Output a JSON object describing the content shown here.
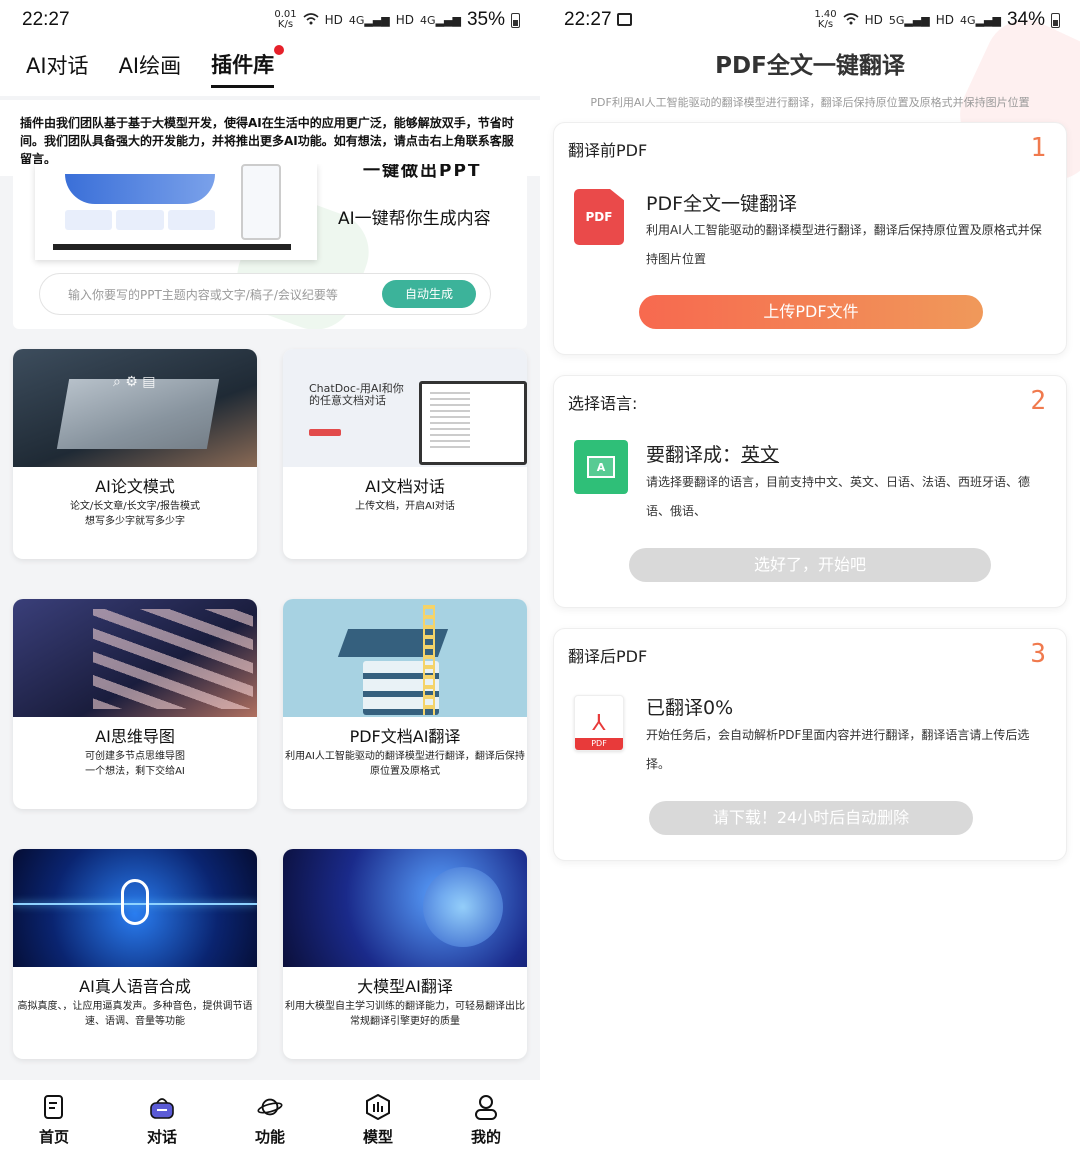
{
  "left": {
    "status": {
      "time": "22:27",
      "speed_top": "0.01",
      "speed_bottom": "K/s",
      "hd1": "HD",
      "net1": "4G",
      "hd2": "HD",
      "net2": "4G",
      "battery": "35%"
    },
    "tabs": [
      {
        "label": "AI对话"
      },
      {
        "label": "AI绘画"
      },
      {
        "label": "插件库"
      }
    ],
    "intro": "插件由我们团队基于基于大模型开发，使得AI在生活中的应用更广泛，能够解放双手，节省时间。我们团队具备强大的开发能力，并将推出更多AI功能。如有想法，请点击右上角联系客服留言。",
    "banner": {
      "cut_text": "一键做出PPT",
      "slogan": "AI一键帮你生成内容",
      "input_placeholder": "输入你要写的PPT主题内容或文字/稿子/会议纪要等",
      "button": "自动生成"
    },
    "doc_image_text": "ChatDoc-用AI和你的任意文档对话",
    "cards": [
      {
        "title": "AI论文模式",
        "desc": "论文/长文章/长文字/报告模式\n想写多少字就写多少字"
      },
      {
        "title": "AI文档对话",
        "desc": "上传文档，开启AI对话"
      },
      {
        "title": "AI思维导图",
        "desc": "可创建多节点思维导图\n一个想法，剩下交给AI"
      },
      {
        "title": "PDF文档AI翻译",
        "desc": "利用AI人工智能驱动的翻译模型进行翻译，翻译后保持原位置及原格式"
      },
      {
        "title": "AI真人语音合成",
        "desc": "高拟真度、，让应用逼真发声。多种音色，提供调节语速、语调、音量等功能"
      },
      {
        "title": "大模型AI翻译",
        "desc": "利用大模型自主学习训练的翻译能力，可轻易翻译出比常规翻译引擎更好的质量"
      }
    ],
    "nav": [
      {
        "label": "首页",
        "icon": "document-icon"
      },
      {
        "label": "对话",
        "icon": "chat-bag-icon"
      },
      {
        "label": "功能",
        "icon": "planet-icon"
      },
      {
        "label": "模型",
        "icon": "model-icon"
      },
      {
        "label": "我的",
        "icon": "user-icon"
      }
    ]
  },
  "right": {
    "status": {
      "time": "22:27",
      "speed_top": "1.40",
      "speed_bottom": "K/s",
      "hd1": "HD",
      "net1": "5G",
      "hd2": "HD",
      "net2": "4G",
      "battery": "34%"
    },
    "title": "PDF全文一键翻译",
    "subtitle": "PDF利用AI人工智能驱动的翻译模型进行翻译，翻译后保持原位置及原格式并保持图片位置",
    "steps": [
      {
        "header": "翻译前PDF",
        "num": "1",
        "heading": "PDF全文一键翻译",
        "text": "利用AI人工智能驱动的翻译模型进行翻译，翻译后保持原位置及原格式并保持图片位置",
        "button": "上传PDF文件",
        "icon_label": "PDF"
      },
      {
        "header": "选择语言:",
        "num": "2",
        "heading_prefix": "要翻译成：",
        "heading_lang": "英文",
        "text": "请选择要翻译的语言，目前支持中文、英文、日语、法语、西班牙语、德语、俄语、",
        "button": "选好了，开始吧",
        "icon_label": "A"
      },
      {
        "header": "翻译后PDF",
        "num": "3",
        "heading": "已翻译0%",
        "text": "开始任务后，会自动解析PDF里面内容并进行翻译，翻译语言请上传后选择。",
        "button": "请下载！24小时后自动删除",
        "icon_label": "PDF"
      }
    ],
    "colors": {
      "accent_gradient_start": "#f7694f",
      "accent_gradient_end": "#f0995a",
      "disabled": "#d9d9d9",
      "step_num": "#f07a4e"
    }
  }
}
